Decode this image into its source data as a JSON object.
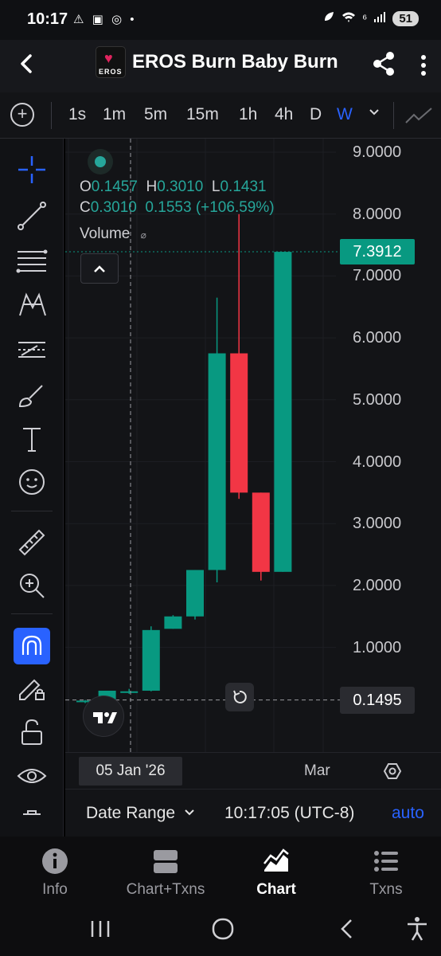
{
  "status_bar": {
    "time": "10:17",
    "status_icons": "⚠ ▣ ◎ •",
    "network": "⁶",
    "battery": "51"
  },
  "header": {
    "title": "EROS Burn Baby Burn",
    "logo_text": "EROS"
  },
  "intervals": [
    {
      "label": "1s",
      "active": false
    },
    {
      "label": "1m",
      "active": false
    },
    {
      "label": "5m",
      "active": false
    },
    {
      "label": "15m",
      "active": false
    },
    {
      "label": "1h",
      "active": false
    },
    {
      "label": "4h",
      "active": false
    },
    {
      "label": "D",
      "active": false
    },
    {
      "label": "W",
      "active": true
    }
  ],
  "legend": {
    "open_label": "O",
    "open": "0.1457",
    "high_label": "H",
    "high": "0.3010",
    "low_label": "L",
    "low": "0.1431",
    "close_label": "C",
    "close": "0.3010",
    "change": "0.1553 (+106.59%)",
    "volume_label": "Volume",
    "volume_icon": "⌀"
  },
  "price_axis": {
    "labels": [
      "9.0000",
      "8.0000",
      "7.0000",
      "6.0000",
      "5.0000",
      "4.0000",
      "3.0000",
      "2.0000",
      "1.0000"
    ],
    "last_price": "7.3912",
    "crosshair_price": "0.1495"
  },
  "time_axis": {
    "crosshair_date": "05 Jan '26",
    "label": "Mar"
  },
  "bottom_bar": {
    "date_range": "Date Range",
    "clock": "10:17:05 (UTC-8)",
    "auto": "auto"
  },
  "tabs": [
    {
      "label": "Info",
      "icon": "info-icon",
      "active": false
    },
    {
      "label": "Chart+Txns",
      "icon": "chart-txns-icon",
      "active": false
    },
    {
      "label": "Chart",
      "icon": "chart-icon",
      "active": true
    },
    {
      "label": "Txns",
      "icon": "txns-icon",
      "active": false
    }
  ],
  "colors": {
    "up": "#089981",
    "down": "#f23645",
    "accent": "#2962ff",
    "background": "#131417"
  },
  "chart_data": {
    "type": "candlestick",
    "interval": "W",
    "ylim": [
      0,
      9
    ],
    "candles": [
      {
        "open": 0.12,
        "high": 0.15,
        "low": 0.1,
        "close": 0.14
      },
      {
        "open": 0.14,
        "high": 0.3,
        "low": 0.14,
        "close": 0.3
      },
      {
        "open": 0.27,
        "high": 0.33,
        "low": 0.25,
        "close": 0.29
      },
      {
        "open": 0.3,
        "high": 1.34,
        "low": 0.29,
        "close": 1.28
      },
      {
        "open": 1.3,
        "high": 1.52,
        "low": 1.3,
        "close": 1.5
      },
      {
        "open": 1.5,
        "high": 2.25,
        "low": 1.45,
        "close": 2.25
      },
      {
        "open": 2.25,
        "high": 6.65,
        "low": 2.05,
        "close": 5.75
      },
      {
        "open": 5.75,
        "high": 8.0,
        "low": 3.4,
        "close": 3.5
      },
      {
        "open": 3.5,
        "high": 3.5,
        "low": 2.08,
        "close": 2.22
      },
      {
        "open": 2.22,
        "high": 7.39,
        "low": 2.22,
        "close": 7.39
      }
    ],
    "last_price": 7.3912
  }
}
